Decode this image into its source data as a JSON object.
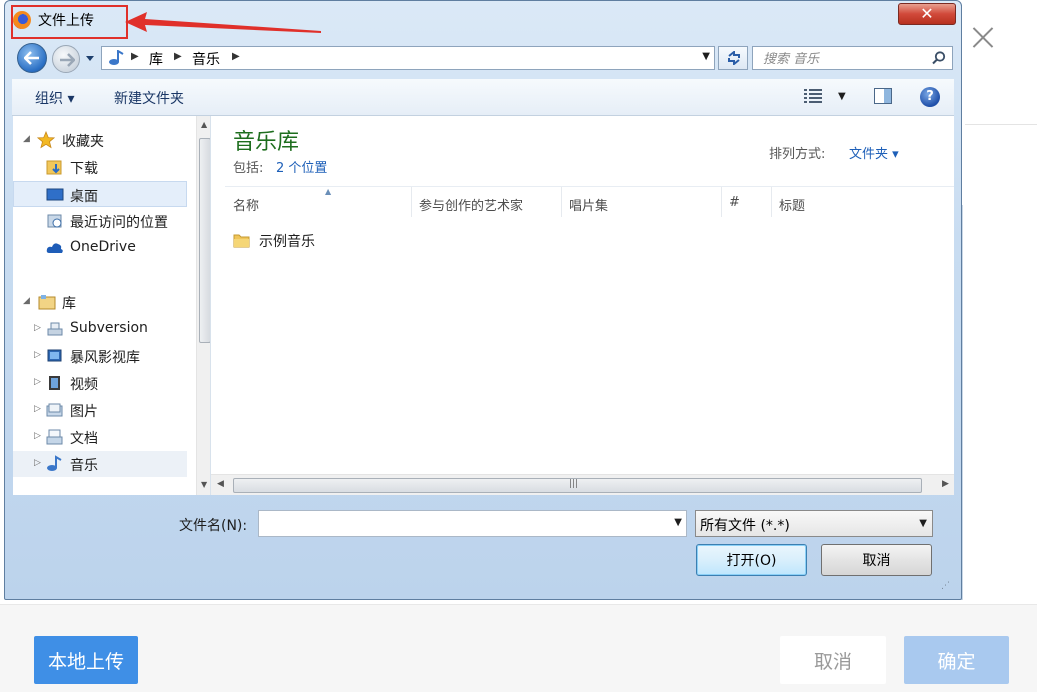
{
  "background_modal": {
    "local_upload_label": "本地上传",
    "cancel_label": "取消",
    "confirm_label": "确定",
    "accent_color": "#3f8fe6",
    "confirm_disabled_color": "#a9c9ef"
  },
  "dialog": {
    "title": "文件上传",
    "close_glyph": "✕",
    "address": {
      "breadcrumbs": [
        "库",
        "音乐"
      ]
    },
    "search": {
      "placeholder": "搜索 音乐"
    },
    "toolbar": {
      "organize_label": "组织 ▾",
      "new_folder_label": "新建文件夹"
    },
    "nav": {
      "favorites": {
        "label": "收藏夹",
        "items": [
          "下载",
          "桌面",
          "最近访问的位置",
          "OneDrive"
        ]
      },
      "libraries": {
        "label": "库",
        "items": [
          "Subversion",
          "暴风影视库",
          "视频",
          "图片",
          "文档",
          "音乐"
        ]
      }
    },
    "content": {
      "library_title": "音乐库",
      "includes_label": "包括:",
      "includes_link": "2 个位置",
      "arrange_label": "排列方式:",
      "arrange_value": "文件夹 ▾",
      "columns": [
        "名称",
        "参与创作的艺术家",
        "唱片集",
        "#",
        "标题"
      ],
      "files": [
        {
          "name": "示例音乐",
          "type": "folder"
        }
      ]
    },
    "bottom": {
      "filename_label": "文件名(N):",
      "filename_value": "",
      "filetype_value": "所有文件 (*.*)",
      "open_label": "打开(O)",
      "cancel_label": "取消"
    }
  },
  "annotation": {
    "color": "#e0302a",
    "target": "dialog-title"
  }
}
